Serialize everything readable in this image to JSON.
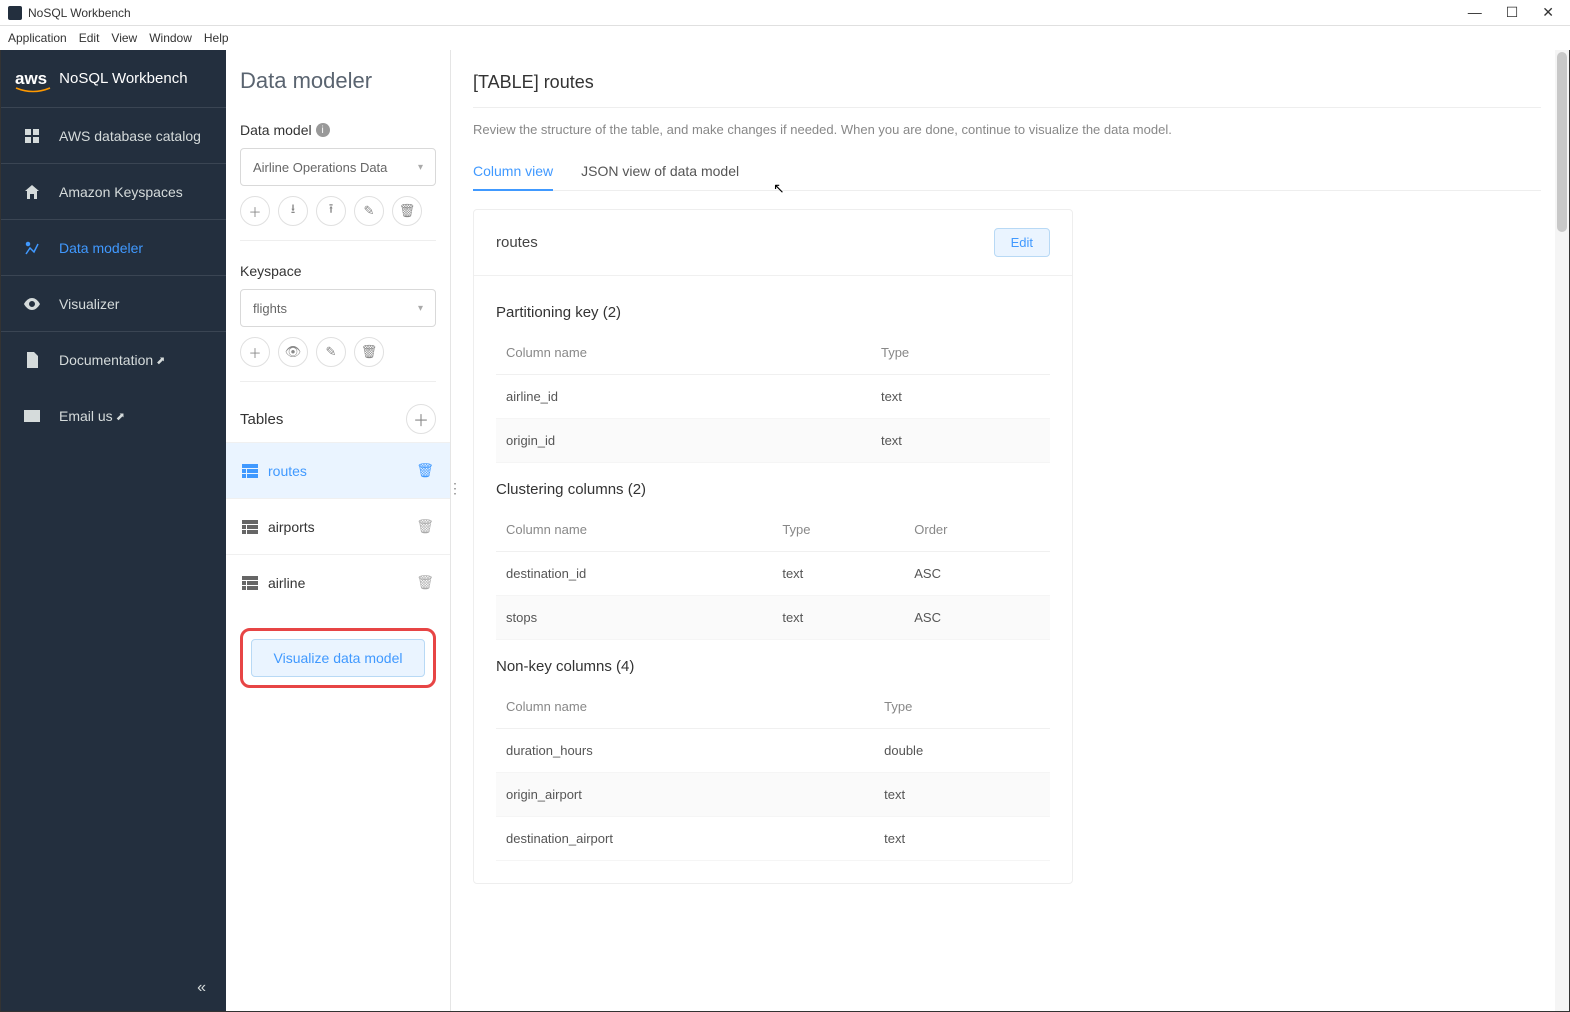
{
  "window": {
    "title": "NoSQL Workbench"
  },
  "menubar": {
    "items": [
      "Application",
      "Edit",
      "View",
      "Window",
      "Help"
    ]
  },
  "sidebar": {
    "logo": "aws",
    "title": "NoSQL Workbench",
    "items": [
      {
        "label": "AWS database catalog"
      },
      {
        "label": "Amazon Keyspaces"
      },
      {
        "label": "Data modeler"
      },
      {
        "label": "Visualizer"
      },
      {
        "label": "Documentation"
      },
      {
        "label": "Email us"
      }
    ]
  },
  "panel": {
    "heading": "Data modeler",
    "model_label": "Data model",
    "model_value": "Airline Operations Data",
    "keyspace_label": "Keyspace",
    "keyspace_value": "flights",
    "tables_label": "Tables",
    "tables": [
      {
        "name": "routes"
      },
      {
        "name": "airports"
      },
      {
        "name": "airline"
      }
    ],
    "visualize_label": "Visualize data model"
  },
  "content": {
    "title": "[TABLE] routes",
    "help": "Review the structure of the table, and make changes if needed. When you are done, continue to visualize the data model.",
    "tabs": {
      "col": "Column view",
      "json": "JSON view of data model"
    },
    "table_name": "routes",
    "edit_label": "Edit",
    "headers": {
      "col": "Column name",
      "type": "Type",
      "order": "Order"
    },
    "sections": {
      "part": {
        "title": "Partitioning key (2)",
        "rows": [
          {
            "c": "airline_id",
            "t": "text"
          },
          {
            "c": "origin_id",
            "t": "text"
          }
        ]
      },
      "clust": {
        "title": "Clustering columns (2)",
        "rows": [
          {
            "c": "destination_id",
            "t": "text",
            "o": "ASC"
          },
          {
            "c": "stops",
            "t": "text",
            "o": "ASC"
          }
        ]
      },
      "nonkey": {
        "title": "Non-key columns (4)",
        "rows": [
          {
            "c": "duration_hours",
            "t": "double"
          },
          {
            "c": "origin_airport",
            "t": "text"
          },
          {
            "c": "destination_airport",
            "t": "text"
          }
        ]
      }
    }
  }
}
